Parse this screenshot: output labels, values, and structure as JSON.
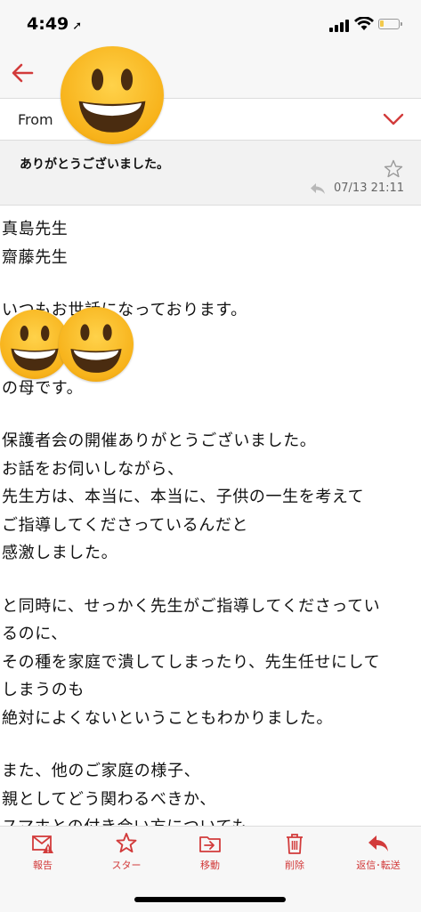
{
  "status_bar": {
    "time": "4:49",
    "battery_level": 0.2
  },
  "header": {
    "from_label": "From",
    "subject": "ありがとうございました。",
    "date": "07/13 21:11"
  },
  "icons": {
    "back": "back-arrow-icon",
    "expand": "chevron-down-icon",
    "star": "star-outline-icon",
    "reply": "reply-icon"
  },
  "colors": {
    "accent": "#d23b3b"
  },
  "body": {
    "lines": [
      "真島先生",
      "齋藤先生",
      "",
      "いつもお世話になっております。",
      "",
      "",
      "の母です。",
      "",
      "保護者会の開催ありがとうございました。",
      "お話をお伺いしながら、",
      "先生方は、本当に、本当に、子供の一生を考えて",
      "ご指導してくださっているんだと",
      "感激しました。",
      "",
      "と同時に、せっかく先生がご指導してくださってい",
      "るのに、",
      "その種を家庭で潰してしまったり、先生任せにして",
      "しまうのも",
      "絶対によくないということもわかりました。",
      "",
      "また、他のご家庭の様子、",
      "親としてどう関わるべきか、",
      "スマホとの付き合い方についても"
    ]
  },
  "toolbar": {
    "items": [
      {
        "label": "報告",
        "icon": "report-icon"
      },
      {
        "label": "スター",
        "icon": "star-icon"
      },
      {
        "label": "移動",
        "icon": "move-folder-icon"
      },
      {
        "label": "削除",
        "icon": "trash-icon"
      },
      {
        "label": "返信･転送",
        "icon": "reply-forward-icon"
      }
    ]
  }
}
